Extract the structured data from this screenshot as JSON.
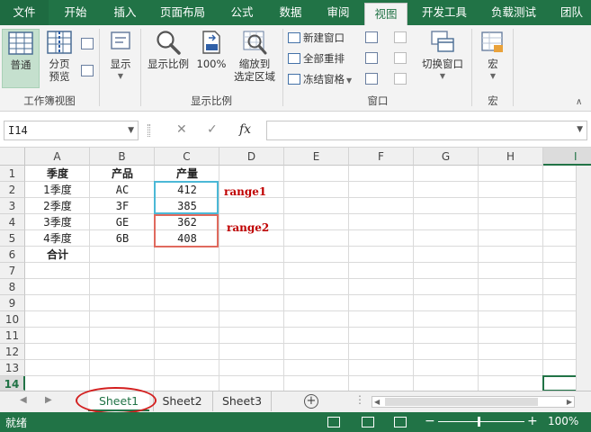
{
  "ribbon_tabs": [
    {
      "label": "文件"
    },
    {
      "label": "开始"
    },
    {
      "label": "插入"
    },
    {
      "label": "页面布局"
    },
    {
      "label": "公式"
    },
    {
      "label": "数据"
    },
    {
      "label": "审阅"
    },
    {
      "label": "视图"
    },
    {
      "label": "开发工具"
    },
    {
      "label": "负载测试"
    },
    {
      "label": "团队"
    }
  ],
  "active_tab": "视图",
  "workbook_views": {
    "normal": "普通",
    "page_break_line1": "分页",
    "page_break_line2": "预览",
    "group_label": "工作簿视图"
  },
  "show": {
    "label": "显示"
  },
  "zoom_group": {
    "zoom": "显示比例",
    "zoom100": "100%",
    "zoom_sel_line1": "缩放到",
    "zoom_sel_line2": "选定区域",
    "group_label": "显示比例"
  },
  "window_group": {
    "new_window": "新建窗口",
    "arrange_all": "全部重排",
    "freeze": "冻结窗格",
    "switch_windows": "切换窗口",
    "group_label": "窗口"
  },
  "macros_group": {
    "macros": "宏",
    "group_label": "宏"
  },
  "formula_bar": {
    "name_box": "I14",
    "fx": "fx",
    "formula": ""
  },
  "columns": [
    "A",
    "B",
    "C",
    "D",
    "E",
    "F",
    "G",
    "H",
    "I"
  ],
  "rows": [
    "1",
    "2",
    "3",
    "4",
    "5",
    "6",
    "7",
    "8",
    "9",
    "10",
    "11",
    "12",
    "13",
    "14"
  ],
  "selected_cell": {
    "col": "I",
    "row": "14"
  },
  "table": {
    "headers": [
      "季度",
      "产品",
      "产量"
    ],
    "rows": [
      [
        "1季度",
        "AC",
        "412"
      ],
      [
        "2季度",
        "3F",
        "385"
      ],
      [
        "3季度",
        "GE",
        "362"
      ],
      [
        "4季度",
        "6B",
        "408"
      ]
    ],
    "total_label": "合计"
  },
  "annotations": [
    {
      "label": "range1",
      "color": "#4bb8d6"
    },
    {
      "label": "range2",
      "color": "#e06a5e"
    }
  ],
  "sheets": [
    {
      "label": "Sheet1"
    },
    {
      "label": "Sheet2"
    },
    {
      "label": "Sheet3"
    }
  ],
  "active_sheet": "Sheet1",
  "status_bar": {
    "ready": "就绪",
    "zoom_minus": "−",
    "zoom_plus": "+",
    "zoom_level": "100%"
  },
  "colors": {
    "accent": "#217346",
    "highlight": "#d31f1f"
  }
}
